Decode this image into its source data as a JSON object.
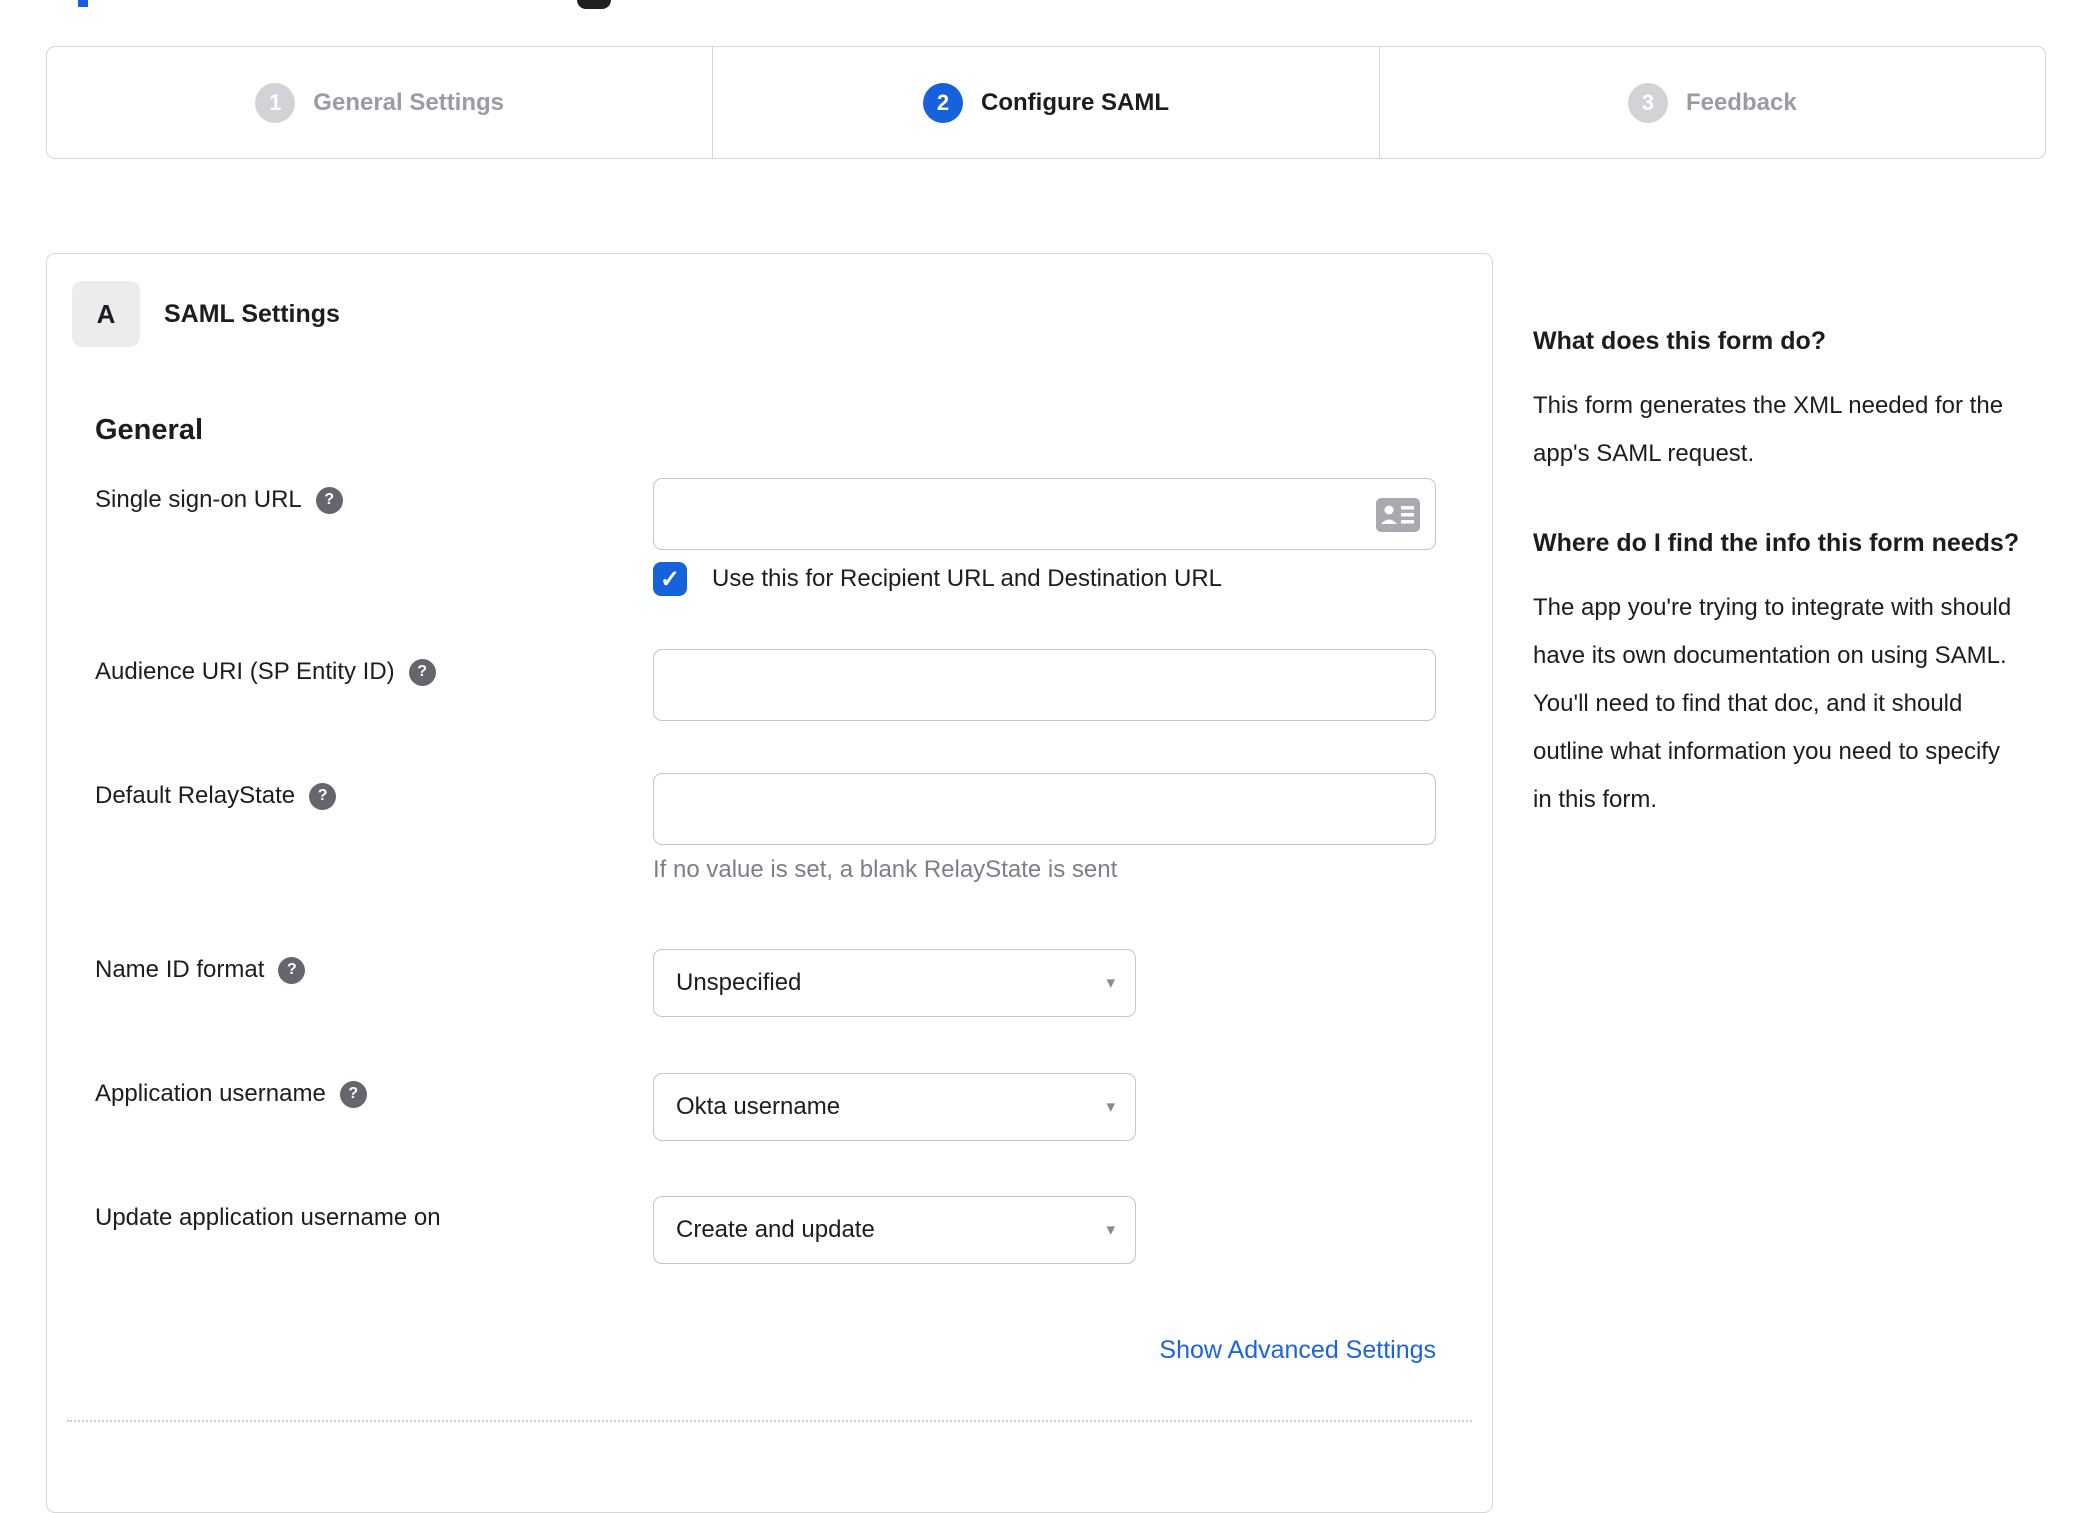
{
  "icons": {
    "help": "?",
    "caret": "▾",
    "check": "✓"
  },
  "colors": {
    "accent_blue": "#1662dd",
    "link_blue": "#1c63dd",
    "inactive_gray": "#d2d2d7",
    "inactive_text": "#9b9ba3",
    "border_gray": "#d6d6da",
    "text_dark": "#1d1d21",
    "hint_gray": "#7e7e89"
  },
  "stepper": {
    "steps": [
      {
        "number": "1",
        "label": "General Settings",
        "state": "inactive"
      },
      {
        "number": "2",
        "label": "Configure SAML",
        "state": "active"
      },
      {
        "number": "3",
        "label": "Feedback",
        "state": "inactive"
      }
    ]
  },
  "panel": {
    "section_badge": "A",
    "section_title": "SAML Settings",
    "group_title": "General",
    "fields": {
      "sso_url": {
        "label": "Single sign-on URL",
        "value": ""
      },
      "sso_checkbox": {
        "label": "Use this for Recipient URL and Destination URL",
        "checked": true
      },
      "audience_uri": {
        "label": "Audience URI (SP Entity ID)",
        "value": ""
      },
      "relay_state": {
        "label": "Default RelayState",
        "value": "",
        "hint": "If no value is set, a blank RelayState is sent"
      },
      "name_id_format": {
        "label": "Name ID format",
        "value": "Unspecified"
      },
      "app_username": {
        "label": "Application username",
        "value": "Okta username"
      },
      "update_username": {
        "label": "Update application username on",
        "value": "Create and update"
      }
    },
    "advanced_link": "Show Advanced Settings"
  },
  "sidebar": {
    "sections": [
      {
        "heading": "What does this form do?",
        "body": "This form generates the XML needed for the app's SAML request."
      },
      {
        "heading": "Where do I find the info this form needs?",
        "body": "The app you're trying to integrate with should have its own documentation on using SAML. You'll need to find that doc, and it should outline what information you need to specify in this form."
      }
    ]
  }
}
